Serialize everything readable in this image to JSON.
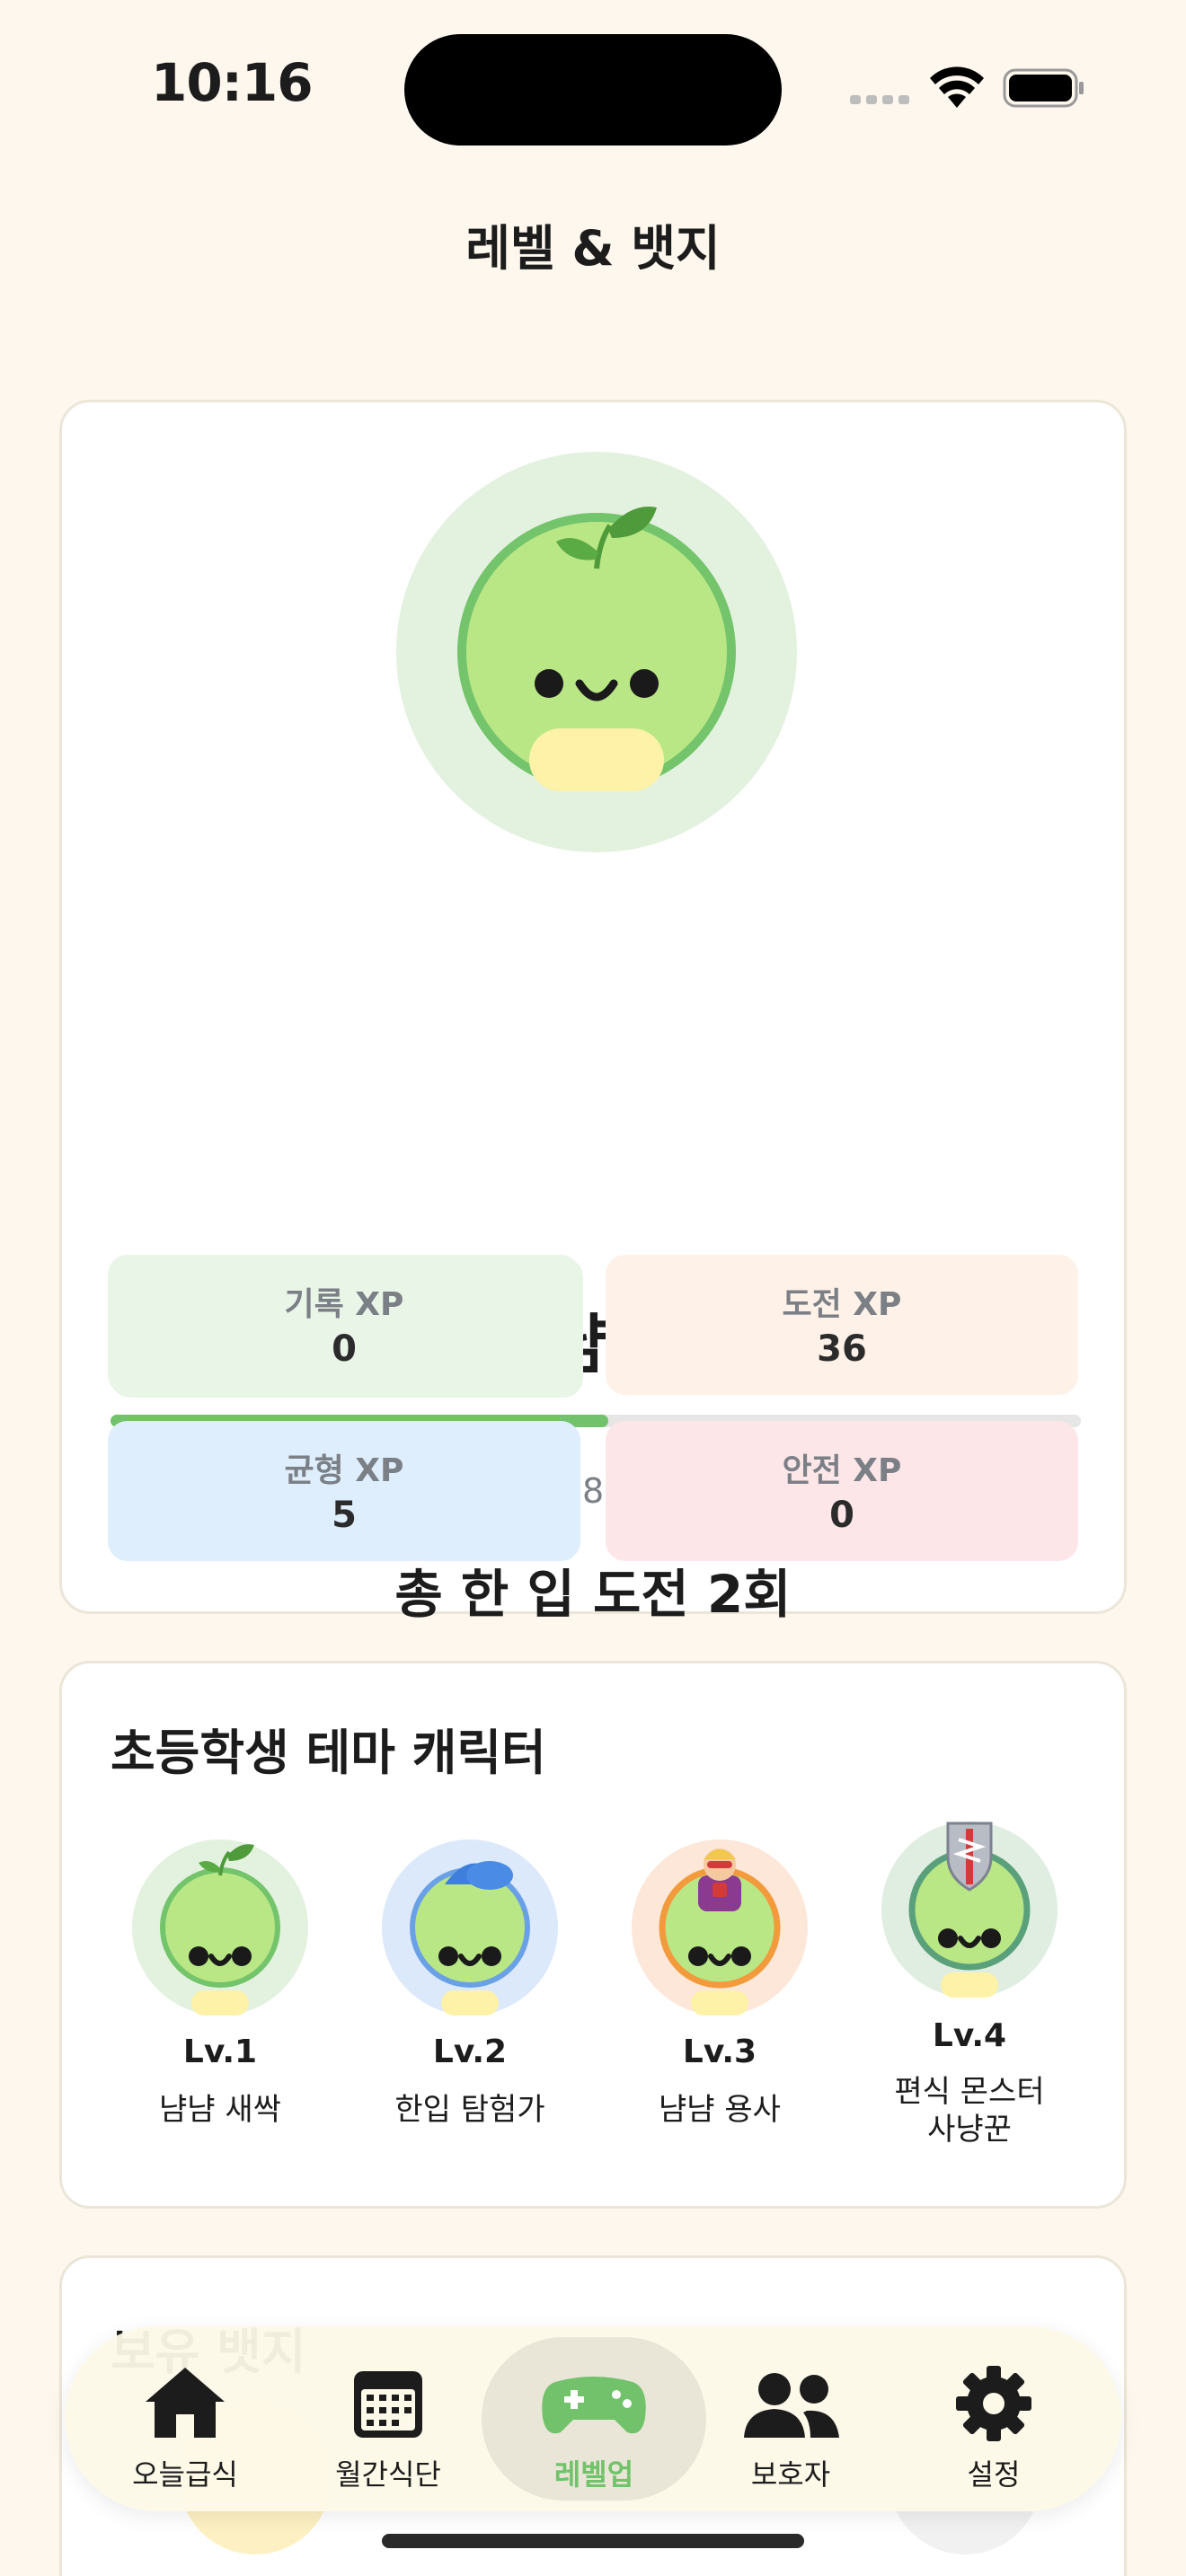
{
  "status": {
    "time": "10:16"
  },
  "header": {
    "title": "레벨 & 뱃지"
  },
  "profile": {
    "level_name": "Lv.1 냠냠 새싹",
    "xp_text": "41 / 80 XP",
    "xp_progress": 0.5125,
    "challenge_text": "총 한 입 도전 2회",
    "stats": [
      {
        "label": "기록 XP",
        "value": "0"
      },
      {
        "label": "도전 XP",
        "value": "36"
      },
      {
        "label": "균형 XP",
        "value": "5"
      },
      {
        "label": "안전 XP",
        "value": "0"
      }
    ]
  },
  "theme_section": {
    "title": "초등학생 테마 캐릭터",
    "characters": [
      {
        "level": "Lv.1",
        "name": "냠냠 새싹",
        "icon": "sprout-character-icon"
      },
      {
        "level": "Lv.2",
        "name": "한입 탐험가",
        "icon": "cap-character-icon"
      },
      {
        "level": "Lv.3",
        "name": "냠냠 용사",
        "icon": "hero-character-icon"
      },
      {
        "level": "Lv.4",
        "name": "편식 몬스터\n사냥꾼",
        "icon": "shield-character-icon"
      }
    ]
  },
  "badges_section": {
    "title": "보유 뱃지"
  },
  "tabs": [
    {
      "label": "오늘급식",
      "icon": "home-icon"
    },
    {
      "label": "월간식단",
      "icon": "calendar-icon"
    },
    {
      "label": "레벨업",
      "icon": "gamepad-icon",
      "active": true
    },
    {
      "label": "보호자",
      "icon": "people-icon"
    },
    {
      "label": "설정",
      "icon": "gear-icon"
    }
  ],
  "colors": {
    "accent": "#71c26a",
    "background": "#fdf7ed",
    "stat_green": "#e9f5e7",
    "stat_orange": "#fdf1e8",
    "stat_blue": "#deeefc",
    "stat_pink": "#fde6e8"
  }
}
